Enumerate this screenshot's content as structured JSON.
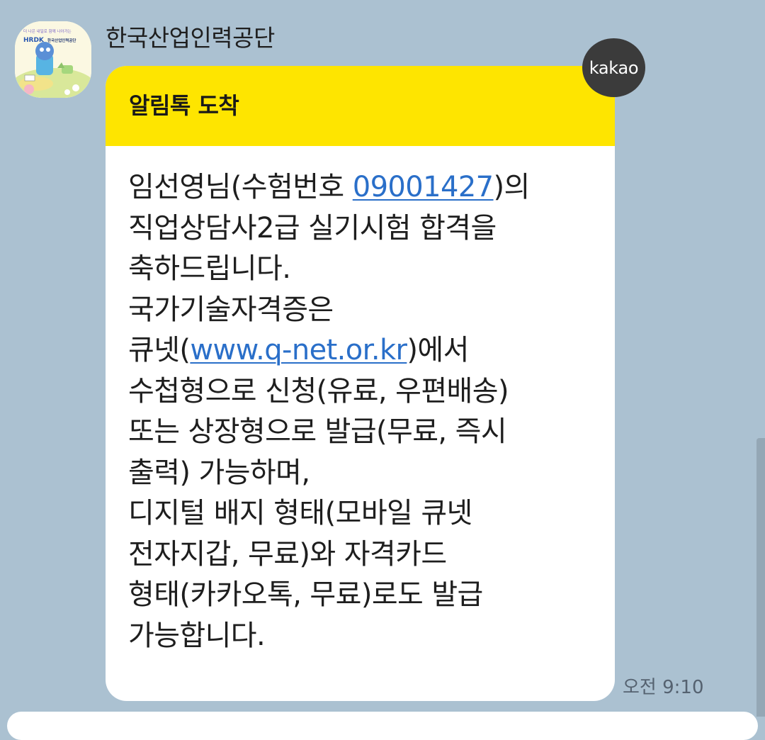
{
  "chat": {
    "sender_name": "한국산업인력공단",
    "avatar_icon": "hrdk-character-icon",
    "avatar_text": {
      "top": "더 나은 내일로 함께 나아가는",
      "brand": "HRDK",
      "org": "한국산업인력공단"
    },
    "badge_label": "kakao",
    "timestamp": "오전 9:10"
  },
  "message": {
    "header_title": "알림톡 도착",
    "lines": [
      {
        "parts": [
          {
            "text": "임선영님(수험번호 "
          },
          {
            "text": "09001427",
            "link": true
          },
          {
            "text": ")의"
          }
        ]
      },
      {
        "parts": [
          {
            "text": "직업상담사2급 실기시험 합격을"
          }
        ]
      },
      {
        "parts": [
          {
            "text": "축하드립니다."
          }
        ]
      },
      {
        "parts": [
          {
            "text": "국가기술자격증은"
          }
        ]
      },
      {
        "parts": [
          {
            "text": "큐넷("
          },
          {
            "text": "www.q-net.or.kr",
            "link": true
          },
          {
            "text": ")에서"
          }
        ]
      },
      {
        "parts": [
          {
            "text": "수첩형으로 신청(유료, 우편배송)"
          }
        ]
      },
      {
        "parts": [
          {
            "text": "또는 상장형으로 발급(무료, 즉시"
          }
        ]
      },
      {
        "parts": [
          {
            "text": "출력) 가능하며,"
          }
        ]
      },
      {
        "parts": [
          {
            "text": "디지털 배지 형태(모바일 큐넷"
          }
        ]
      },
      {
        "parts": [
          {
            "text": "전자지갑, 무료)와 자격카드"
          }
        ]
      },
      {
        "parts": [
          {
            "text": "형태(카카오톡, 무료)로도 발급"
          }
        ]
      },
      {
        "parts": [
          {
            "text": "가능합니다."
          }
        ]
      }
    ]
  },
  "colors": {
    "background": "#abc1d1",
    "header_yellow": "#fee500",
    "link_blue": "#2a6fc9",
    "badge_dark": "#3b3b3b"
  }
}
